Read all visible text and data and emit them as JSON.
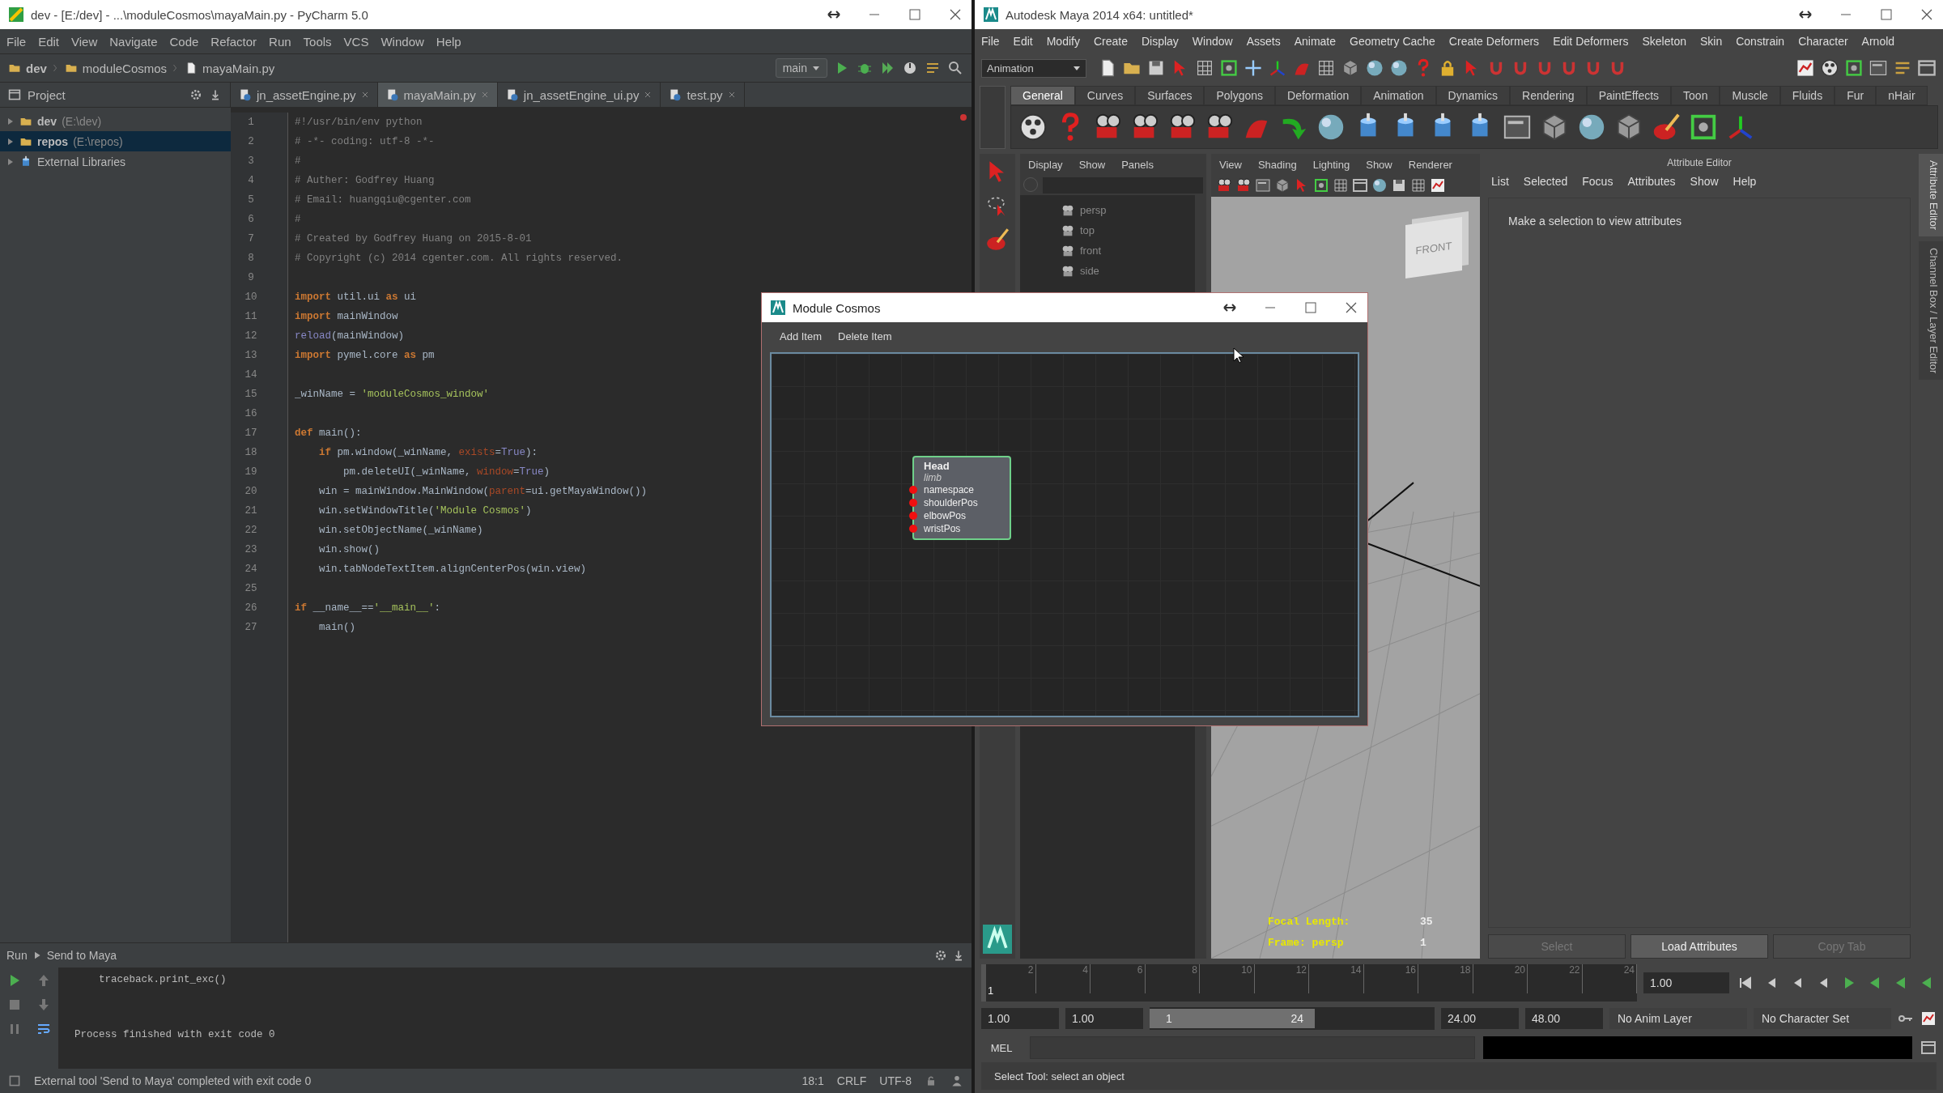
{
  "pycharm": {
    "title": "dev - [E:/dev] - ...\\moduleCosmos\\mayaMain.py - PyCharm 5.0",
    "menu": [
      "File",
      "Edit",
      "View",
      "Navigate",
      "Code",
      "Refactor",
      "Run",
      "Tools",
      "VCS",
      "Window",
      "Help"
    ],
    "breadcrumbs": [
      "dev",
      "moduleCosmos",
      "mayaMain.py"
    ],
    "run_config": "main",
    "project_label": "Project",
    "tabs": [
      {
        "label": "jn_assetEngine.py",
        "selected": false
      },
      {
        "label": "mayaMain.py",
        "selected": true
      },
      {
        "label": "jn_assetEngine_ui.py",
        "selected": false
      },
      {
        "label": "test.py",
        "selected": false
      }
    ],
    "tree": [
      {
        "name": "dev",
        "path": "(E:\\dev)",
        "kind": "folder",
        "selected": false
      },
      {
        "name": "repos",
        "path": "(E:\\repos)",
        "kind": "folder",
        "selected": true
      },
      {
        "name": "External Libraries",
        "kind": "library",
        "selected": false
      }
    ],
    "code": [
      {
        "number": "1",
        "segments": [
          {
            "text": "#!/usr/bin/env python",
            "kind": "comment"
          }
        ]
      },
      {
        "number": "2",
        "segments": [
          {
            "text": "# -*- coding: utf-8 -*-",
            "kind": "comment"
          }
        ]
      },
      {
        "number": "3",
        "segments": [
          {
            "text": "#",
            "kind": "comment"
          }
        ]
      },
      {
        "number": "4",
        "segments": [
          {
            "text": "# Auther: Godfrey Huang",
            "kind": "comment"
          }
        ]
      },
      {
        "number": "5",
        "segments": [
          {
            "text": "# Email: huangqiu@cgenter.com",
            "kind": "comment"
          }
        ]
      },
      {
        "number": "6",
        "segments": [
          {
            "text": "#",
            "kind": "comment"
          }
        ]
      },
      {
        "number": "7",
        "segments": [
          {
            "text": "# Created by Godfrey Huang on 2015-8-01",
            "kind": "comment"
          }
        ]
      },
      {
        "number": "8",
        "segments": [
          {
            "text": "# Copyright (c) 2014 cgenter.com. All rights reserved.",
            "kind": "comment"
          }
        ]
      },
      {
        "number": "9"
      },
      {
        "number": "10",
        "segments": [
          {
            "text": "import",
            "kind": "keyword"
          },
          {
            "text": " util.ui ",
            "kind": "plain"
          },
          {
            "text": "as",
            "kind": "keyword"
          },
          {
            "text": " ui",
            "kind": "plain"
          }
        ]
      },
      {
        "number": "11",
        "segments": [
          {
            "text": "import",
            "kind": "keyword"
          },
          {
            "text": " mainWindow",
            "kind": "plain"
          }
        ]
      },
      {
        "number": "12",
        "segments": [
          {
            "text": "reload",
            "kind": "builtin"
          },
          {
            "text": "(mainWindow)",
            "kind": "plain"
          }
        ]
      },
      {
        "number": "13",
        "segments": [
          {
            "text": "import",
            "kind": "keyword"
          },
          {
            "text": " pymel.core ",
            "kind": "plain"
          },
          {
            "text": "as",
            "kind": "keyword"
          },
          {
            "text": " pm",
            "kind": "plain"
          }
        ]
      },
      {
        "number": "14"
      },
      {
        "number": "15",
        "segments": [
          {
            "text": "_winName = ",
            "kind": "plain"
          },
          {
            "text": "'moduleCosmos_window'",
            "kind": "string"
          }
        ]
      },
      {
        "number": "16"
      },
      {
        "number": "17",
        "segments": [
          {
            "text": "def",
            "kind": "keyword"
          },
          {
            "text": " main():",
            "kind": "plain"
          }
        ]
      },
      {
        "number": "18",
        "segments": [
          {
            "text": "    if",
            "kind": "keyword"
          },
          {
            "text": " pm.window(_winName, ",
            "kind": "plain"
          },
          {
            "text": "exists",
            "kind": "param"
          },
          {
            "text": "=",
            "kind": "plain"
          },
          {
            "text": "True",
            "kind": "builtin"
          },
          {
            "text": "):",
            "kind": "plain"
          }
        ]
      },
      {
        "number": "19",
        "segments": [
          {
            "text": "        pm.deleteUI(_winName, ",
            "kind": "plain"
          },
          {
            "text": "window",
            "kind": "param"
          },
          {
            "text": "=",
            "kind": "plain"
          },
          {
            "text": "True",
            "kind": "builtin"
          },
          {
            "text": ")",
            "kind": "plain"
          }
        ]
      },
      {
        "number": "20",
        "segments": [
          {
            "text": "    win = mainWindow.MainWindow(",
            "kind": "plain"
          },
          {
            "text": "parent",
            "kind": "param"
          },
          {
            "text": "=ui.getMayaWindow())",
            "kind": "plain"
          }
        ]
      },
      {
        "number": "21",
        "segments": [
          {
            "text": "    win.setWindowTitle(",
            "kind": "plain"
          },
          {
            "text": "'Module Cosmos'",
            "kind": "string"
          },
          {
            "text": ")",
            "kind": "plain"
          }
        ]
      },
      {
        "number": "22",
        "segments": [
          {
            "text": "    win.setObjectName(_winName)",
            "kind": "plain"
          }
        ]
      },
      {
        "number": "23",
        "segments": [
          {
            "text": "    win.show()",
            "kind": "plain"
          }
        ]
      },
      {
        "number": "24",
        "segments": [
          {
            "text": "    win.tabNodeTextItem.alignCenterPos(win.view)",
            "kind": "plain"
          }
        ]
      },
      {
        "number": "25"
      },
      {
        "number": "26",
        "segments": [
          {
            "text": "if",
            "kind": "keyword"
          },
          {
            "text": " __name__==",
            "kind": "plain"
          },
          {
            "text": "'__main__'",
            "kind": "string"
          },
          {
            "text": ":",
            "kind": "plain"
          }
        ]
      },
      {
        "number": "27",
        "segments": [
          {
            "text": "    main()",
            "kind": "plain"
          }
        ]
      }
    ],
    "run_label": "Run",
    "run_target": "Send to Maya",
    "console": [
      "    traceback.print_exc()",
      "Process finished with exit code 0"
    ],
    "status": {
      "message": "External tool 'Send to Maya' completed with exit code 0",
      "position": "18:1",
      "line_separator": "CRLF",
      "encoding": "UTF-8"
    }
  },
  "maya": {
    "title": "Autodesk Maya 2014 x64: untitled*",
    "menu": [
      "File",
      "Edit",
      "Modify",
      "Create",
      "Display",
      "Window",
      "Assets",
      "Animate",
      "Geometry Cache",
      "Create Deformers",
      "Edit Deformers",
      "Skeleton",
      "Skin",
      "Constrain",
      "Character",
      "Arnold"
    ],
    "menu_set": "Animation",
    "shelf_tabs": [
      {
        "label": "General",
        "selected": true
      },
      {
        "label": "Curves",
        "selected": false
      },
      {
        "label": "Surfaces",
        "selected": false
      },
      {
        "label": "Polygons",
        "selected": false
      },
      {
        "label": "Deformation",
        "selected": false
      },
      {
        "label": "Animation",
        "selected": false
      },
      {
        "label": "Dynamics",
        "selected": false
      },
      {
        "label": "Rendering",
        "selected": false
      },
      {
        "label": "PaintEffects",
        "selected": false
      },
      {
        "label": "Toon",
        "selected": false
      },
      {
        "label": "Muscle",
        "selected": false
      },
      {
        "label": "Fluids",
        "selected": false
      },
      {
        "label": "Fur",
        "selected": false
      },
      {
        "label": "nHair",
        "selected": false
      }
    ],
    "outliner": {
      "menu": [
        "Display",
        "Show",
        "Panels"
      ],
      "items": [
        "persp",
        "top",
        "front",
        "side"
      ]
    },
    "viewport": {
      "menu": [
        "View",
        "Shading",
        "Lighting",
        "Show",
        "Renderer"
      ],
      "cube_label": "FRONT",
      "hud": [
        {
          "label": "Focal Length:",
          "value": "35"
        },
        {
          "label": "Frame:  persp",
          "value": "1"
        }
      ]
    },
    "attribute_editor": {
      "title": "Attribute Editor",
      "menu": [
        "List",
        "Selected",
        "Focus",
        "Attributes",
        "Show",
        "Help"
      ],
      "message": "Make a selection to view attributes",
      "buttons": [
        {
          "label": "Select",
          "disabled": true
        },
        {
          "label": "Load Attributes",
          "disabled": false
        },
        {
          "label": "Copy Tab",
          "disabled": true
        }
      ]
    },
    "side_tabs": [
      {
        "label": "Attribute Editor",
        "selected": true
      },
      {
        "label": "Channel Box / Layer Editor",
        "selected": false
      }
    ],
    "time_slider": {
      "ticks": [
        "2",
        "4",
        "6",
        "8",
        "10",
        "12",
        "14",
        "16",
        "18",
        "20",
        "22",
        "24"
      ],
      "current": "1",
      "level": 0,
      "field": "1.00"
    },
    "range": {
      "start_field": "1.00",
      "inner_start_field": "1.00",
      "slider_start": "1",
      "slider_end": "24",
      "level": 0.58,
      "inner_end_field": "24.00",
      "end_field": "48.00",
      "anim_layer": "No Anim Layer",
      "character_set": "No Character Set"
    },
    "command_label": "MEL",
    "help_line": "Select Tool: select an object"
  },
  "dialog": {
    "title": "Module Cosmos",
    "menu": [
      "Add Item",
      "Delete Item"
    ],
    "node": {
      "title": "Head",
      "type": "limb",
      "ports": [
        "namespace",
        "shoulderPos",
        "elbowPos",
        "wristPos"
      ]
    }
  }
}
